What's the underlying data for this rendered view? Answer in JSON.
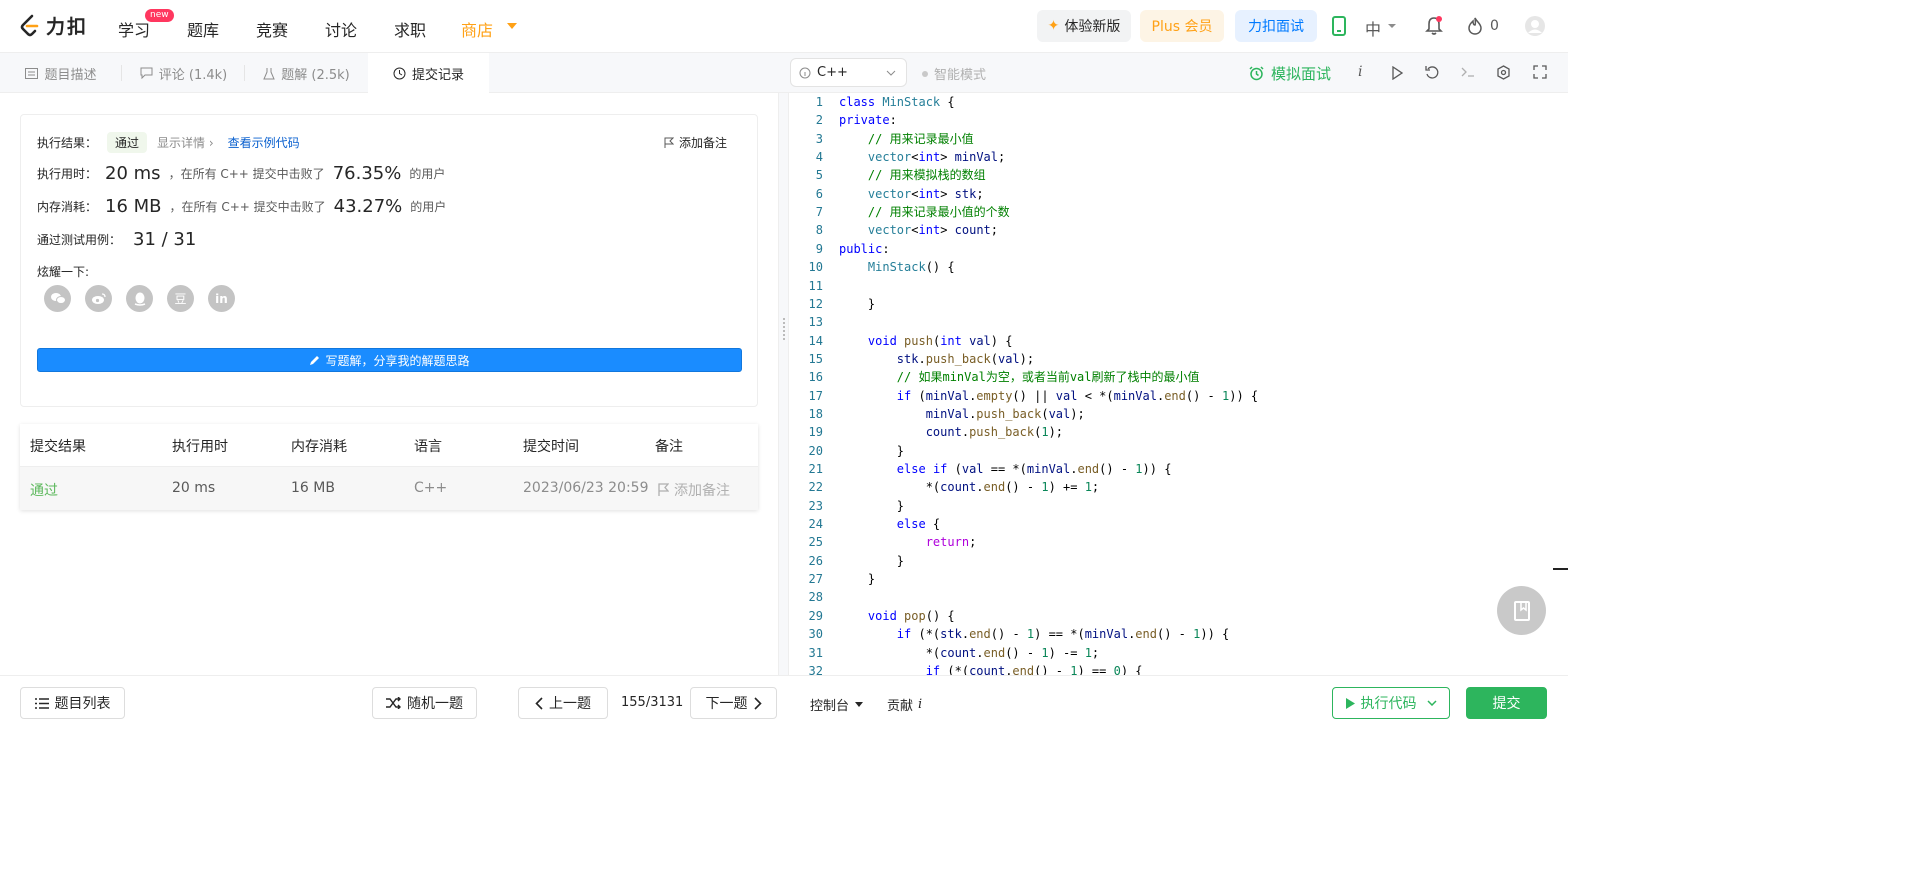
{
  "nav": {
    "logo_text": "力扣",
    "items": [
      "学习",
      "题库",
      "竞赛",
      "讨论",
      "求职",
      "商店"
    ],
    "new_badge": "new",
    "btn_new_version": "体验新版",
    "btn_plus": "Plus 会员",
    "btn_interview": "力扣面试",
    "lang": "中",
    "points": "0"
  },
  "tabs": {
    "description": "题目描述",
    "comments": "评论 (1.4k)",
    "solutions": "题解 (2.5k)",
    "submissions": "提交记录"
  },
  "editor_bar": {
    "language": "C++",
    "smart_mode": "智能模式",
    "mock_interview": "模拟面试",
    "info_icon_text": "i"
  },
  "result": {
    "label_result": "执行结果：",
    "status": "通过",
    "show_details": "显示详情",
    "view_sample": "查看示例代码",
    "add_note": "添加备注",
    "label_time": "执行用时：",
    "time_value": "20 ms",
    "time_mid": "，在所有 C++ 提交中击败了",
    "time_pct": "76.35%",
    "users_suffix": "的用户",
    "label_mem": "内存消耗：",
    "mem_value": "16 MB",
    "mem_mid": "，在所有 C++ 提交中击败了",
    "mem_pct": "43.27%",
    "label_cases": "通过测试用例：",
    "cases_value": "31 / 31",
    "share_label": "炫耀一下:",
    "share_douban": "豆",
    "share_linkedin": "in",
    "write_solution": "写题解，分享我的解题思路"
  },
  "table": {
    "headers": [
      "提交结果",
      "执行用时",
      "内存消耗",
      "语言",
      "提交时间",
      "备注"
    ],
    "row": {
      "status": "通过",
      "time": "20 ms",
      "memory": "16 MB",
      "language": "C++",
      "submitted": "2023/06/23 20:59",
      "note": "添加备注"
    }
  },
  "code": {
    "line_numbers": [
      "1",
      "2",
      "3",
      "4",
      "5",
      "6",
      "7",
      "8",
      "9",
      "10",
      "11",
      "12",
      "13",
      "14",
      "15",
      "16",
      "17",
      "18",
      "19",
      "20",
      "21",
      "22",
      "23",
      "24",
      "25",
      "26",
      "27",
      "28",
      "29",
      "30",
      "31",
      "32"
    ],
    "text": [
      "class MinStack {",
      "private:",
      "    // 用来记录最小值",
      "    vector<int> minVal;",
      "    // 用来模拟栈的数组",
      "    vector<int> stk;",
      "    // 用来记录最小值的个数",
      "    vector<int> count;",
      "public:",
      "    MinStack() {",
      "",
      "    }",
      "",
      "    void push(int val) {",
      "        stk.push_back(val);",
      "        // 如果minVal为空，或者当前val刷新了栈中的最小值",
      "        if (minVal.empty() || val < *(minVal.end() - 1)) {",
      "            minVal.push_back(val);",
      "            count.push_back(1);",
      "        }",
      "        else if (val == *(minVal.end() - 1)) {",
      "            *(count.end() - 1) += 1;",
      "        }",
      "        else {",
      "            return;",
      "        }",
      "    }",
      "",
      "    void pop() {",
      "        if (*(stk.end() - 1) == *(minVal.end() - 1)) {",
      "            *(count.end() - 1) -= 1;",
      "            if (*(count.end() - 1) == 0) {"
    ]
  },
  "bottom": {
    "problem_list": "题目列表",
    "random": "随机一题",
    "prev": "上一题",
    "page": "155/3131",
    "next": "下一题",
    "console": "控制台",
    "contribute": "贡献",
    "contribute_i": "i",
    "run": "执行代码",
    "submit": "提交"
  },
  "colors": {
    "accent_green": "#2db55d",
    "accent_orange": "#ffa116",
    "link_blue": "#1a8cff",
    "pass_green": "#2db55d"
  }
}
